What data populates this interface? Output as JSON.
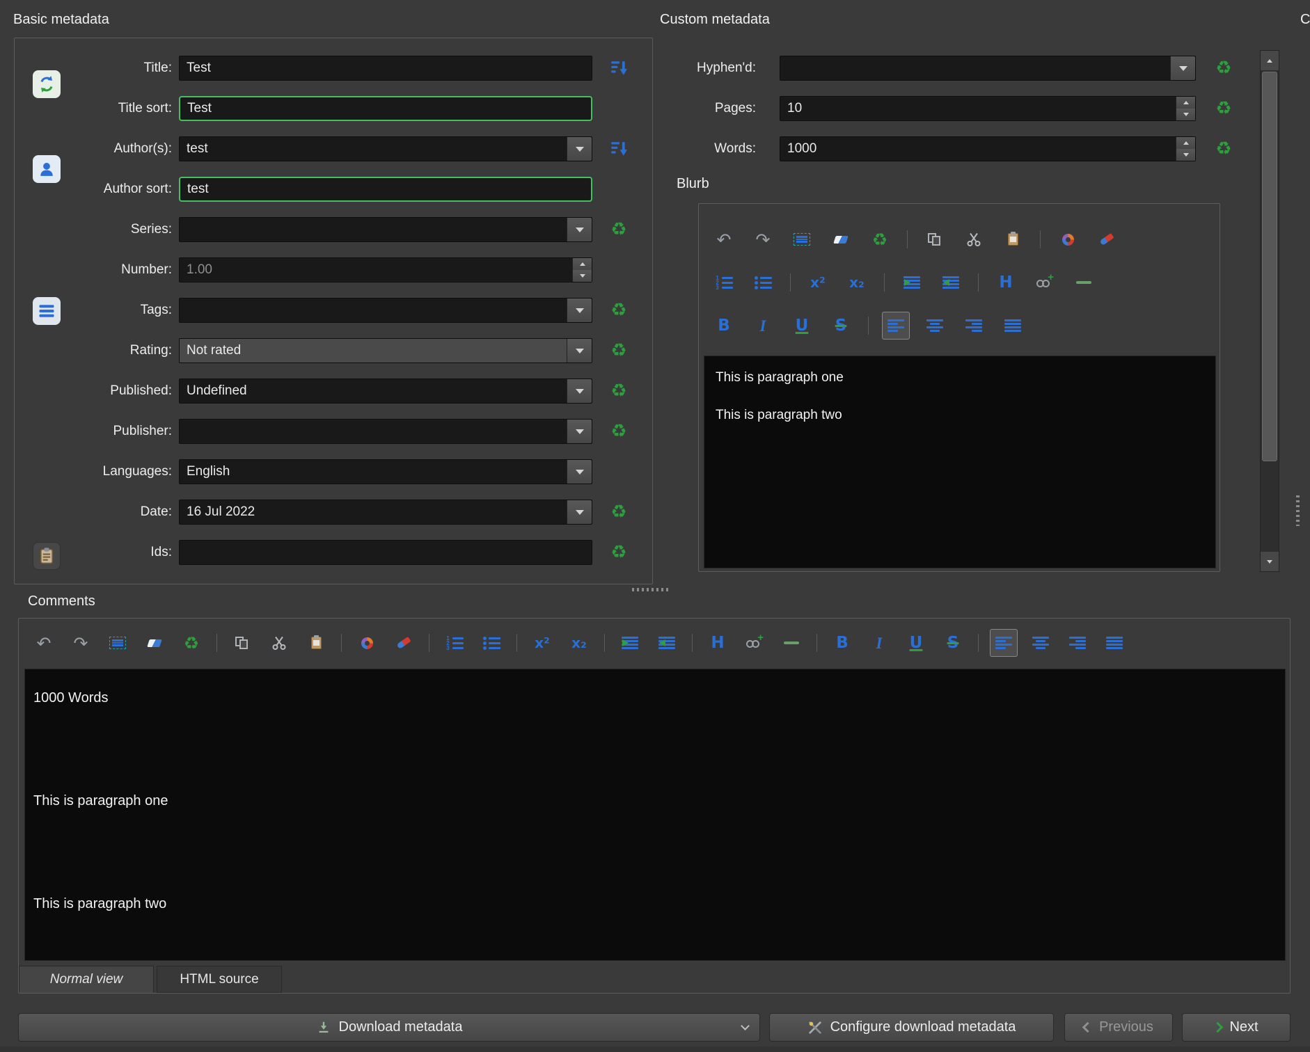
{
  "icons": {
    "recycle": "♻",
    "undo": "↶",
    "redo": "↷"
  },
  "basic_metadata": {
    "title": "Basic metadata",
    "fields": {
      "title": {
        "label": "Title:",
        "value": "Test"
      },
      "title_sort": {
        "label": "Title sort:",
        "value": "Test"
      },
      "authors": {
        "label": "Author(s):",
        "value": "test"
      },
      "author_sort": {
        "label": "Author sort:",
        "value": "test"
      },
      "series": {
        "label": "Series:",
        "value": ""
      },
      "number": {
        "label": "Number:",
        "value": "1.00"
      },
      "tags": {
        "label": "Tags:",
        "value": ""
      },
      "rating": {
        "label": "Rating:",
        "value": "Not rated"
      },
      "published": {
        "label": "Published:",
        "value": "Undefined"
      },
      "publisher": {
        "label": "Publisher:",
        "value": ""
      },
      "languages": {
        "label": "Languages:",
        "value": "English"
      },
      "date": {
        "label": "Date:",
        "value": "16 Jul 2022"
      },
      "ids": {
        "label": "Ids:",
        "value": ""
      }
    }
  },
  "custom_metadata": {
    "title": "Custom metadata",
    "next_panel_truncated": "C",
    "fields": {
      "hyphend": {
        "label": "Hyphen'd:",
        "value": ""
      },
      "pages": {
        "label": "Pages:",
        "value": "10"
      },
      "words": {
        "label": "Words:",
        "value": "1000"
      }
    },
    "blurb": {
      "label": "Blurb",
      "paragraphs": [
        "This is paragraph one",
        "This is paragraph two"
      ]
    }
  },
  "comments": {
    "title": "Comments",
    "paragraphs": [
      "1000 Words",
      "This is paragraph one",
      "This is paragraph two"
    ],
    "tabs": [
      {
        "label": "Normal view",
        "active": true
      },
      {
        "label": "HTML source",
        "active": false
      }
    ]
  },
  "toolbars": {
    "blurb_rows": [
      [
        "undo",
        "redo",
        "select-all",
        "eraser",
        "clean-formatting",
        "|",
        "copy",
        "cut",
        "paste",
        "|",
        "fill-color",
        "format-brush"
      ],
      [
        "ordered-list",
        "bullet-list",
        "|",
        "superscript",
        "subscript",
        "|",
        "indent",
        "outdent",
        "|",
        "heading",
        "insert-link",
        "horizontal-rule"
      ],
      [
        "bold",
        "italic",
        "underline",
        "strikethrough",
        "|",
        "align-left",
        "align-center",
        "align-right",
        "align-justify"
      ]
    ],
    "blurb_active": "align-left",
    "comments_row": [
      "undo",
      "redo",
      "select-all",
      "eraser",
      "clean-formatting",
      "|",
      "copy",
      "cut",
      "paste",
      "|",
      "fill-color",
      "format-brush",
      "|",
      "ordered-list",
      "bullet-list",
      "|",
      "superscript",
      "subscript",
      "|",
      "indent",
      "outdent",
      "|",
      "heading",
      "insert-link",
      "horizontal-rule",
      "|",
      "bold",
      "italic",
      "underline",
      "strikethrough",
      "|",
      "align-left",
      "align-center",
      "align-right",
      "align-justify"
    ],
    "comments_active": "align-left"
  },
  "footer": {
    "download": "Download metadata",
    "configure": "Configure download metadata",
    "previous": "Previous",
    "next": "Next"
  },
  "colors": {
    "accent_blue": "#2a6fd6",
    "accent_green": "#2f9e3f",
    "highlight_border": "#43c162",
    "background": "#3a3a3a",
    "field_background": "#191919"
  }
}
